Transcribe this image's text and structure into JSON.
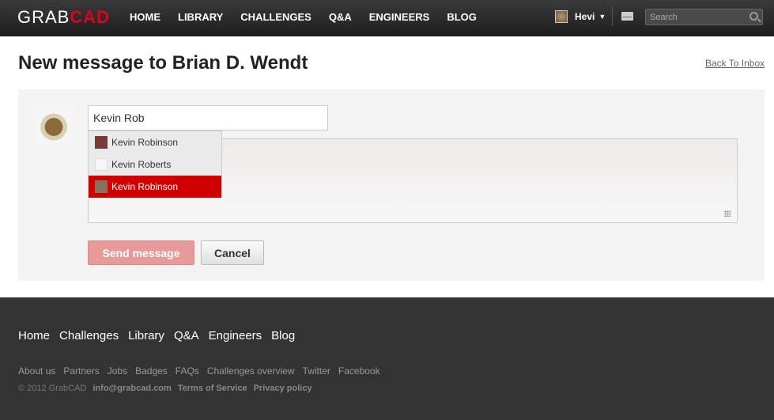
{
  "topbar": {
    "logo_grab": "GRAB",
    "logo_cad": "CAD",
    "nav": [
      "HOME",
      "LIBRARY",
      "CHALLENGES",
      "Q&A",
      "ENGINEERS",
      "BLOG"
    ],
    "user_name": "Hevi",
    "search_placeholder": "Search"
  },
  "page": {
    "title": "New message to Brian D. Wendt",
    "back_link": "Back To Inbox"
  },
  "form": {
    "to_value": "Kevin Rob",
    "suggestions": [
      {
        "name": "Kevin Robinson",
        "active": false,
        "thumb_color": "#7a3a3a"
      },
      {
        "name": "Kevin Roberts",
        "active": false,
        "thumb_color": "#f0f0f0"
      },
      {
        "name": "Kevin Robinson",
        "active": true,
        "thumb_color": "#8a7060"
      }
    ],
    "send_label": "Send message",
    "cancel_label": "Cancel"
  },
  "footer": {
    "nav": [
      "Home",
      "Challenges",
      "Library",
      "Q&A",
      "Engineers",
      "Blog"
    ],
    "links": [
      "About us",
      "Partners",
      "Jobs",
      "Badges",
      "FAQs",
      "Challenges overview",
      "Twitter",
      "Facebook"
    ],
    "copyright": "© 2012 GrabCAD",
    "email": "info@grabcad.com",
    "terms": "Terms of Service",
    "privacy": "Privacy policy"
  },
  "colors": {
    "brand_red": "#e0001a",
    "active_red": "#d00000",
    "send_button": "#e89a98"
  }
}
